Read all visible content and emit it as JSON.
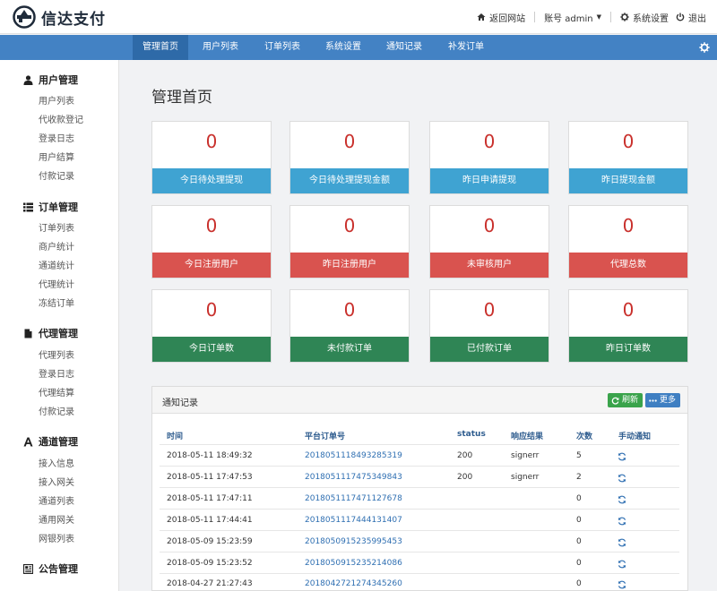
{
  "header": {
    "brand": "信达支付",
    "back_site": "返回网站",
    "account": "账号 admin",
    "settings": "系统设置",
    "logout": "退出"
  },
  "nav": {
    "items": [
      "管理首页",
      "用户列表",
      "订单列表",
      "系统设置",
      "通知记录",
      "补发订单"
    ],
    "active_index": 0
  },
  "sidebar": {
    "groups": [
      {
        "title": "用户管理",
        "icon": "user-icon",
        "items": [
          "用户列表",
          "代收款登记",
          "登录日志",
          "用户结算",
          "付款记录"
        ]
      },
      {
        "title": "订单管理",
        "icon": "list-icon",
        "items": [
          "订单列表",
          "商户统计",
          "通道统计",
          "代理统计",
          "冻结订单"
        ]
      },
      {
        "title": "代理管理",
        "icon": "document-icon",
        "items": [
          "代理列表",
          "登录日志",
          "代理结算",
          "付款记录"
        ]
      },
      {
        "title": "通道管理",
        "icon": "font-icon",
        "items": [
          "接入信息",
          "接入网关",
          "通道列表",
          "通用网关",
          "网银列表"
        ]
      },
      {
        "title": "公告管理",
        "icon": "newspaper-icon",
        "items": []
      }
    ]
  },
  "main": {
    "title": "管理首页",
    "stats": [
      {
        "value": "0",
        "label": "今日待处理提现",
        "color": "#3fa3d2"
      },
      {
        "value": "0",
        "label": "今日待处理提现金额",
        "color": "#3fa3d2"
      },
      {
        "value": "0",
        "label": "昨日申请提现",
        "color": "#3fa3d2"
      },
      {
        "value": "0",
        "label": "昨日提现金额",
        "color": "#3fa3d2"
      },
      {
        "value": "0",
        "label": "今日注册用户",
        "color": "#d9534f"
      },
      {
        "value": "0",
        "label": "昨日注册用户",
        "color": "#d9534f"
      },
      {
        "value": "0",
        "label": "未审核用户",
        "color": "#d9534f"
      },
      {
        "value": "0",
        "label": "代理总数",
        "color": "#d9534f"
      },
      {
        "value": "0",
        "label": "今日订单数",
        "color": "#2f8555"
      },
      {
        "value": "0",
        "label": "未付款订单",
        "color": "#2f8555"
      },
      {
        "value": "0",
        "label": "已付款订单",
        "color": "#2f8555"
      },
      {
        "value": "0",
        "label": "昨日订单数",
        "color": "#2f8555"
      }
    ],
    "notify": {
      "title": "通知记录",
      "refresh": "刷新",
      "more": "更多",
      "columns": [
        "时间",
        "平台订单号",
        "status",
        "响应结果",
        "次数",
        "手动通知"
      ],
      "rows": [
        {
          "time": "2018-05-11 18:49:32",
          "order": "2018051118493285319",
          "status": "200",
          "result": "signerr",
          "count": "5"
        },
        {
          "time": "2018-05-11 17:47:53",
          "order": "2018051117475349843",
          "status": "200",
          "result": "signerr",
          "count": "2"
        },
        {
          "time": "2018-05-11 17:47:11",
          "order": "2018051117471127678",
          "status": "",
          "result": "",
          "count": "0"
        },
        {
          "time": "2018-05-11 17:44:41",
          "order": "2018051117444131407",
          "status": "",
          "result": "",
          "count": "0"
        },
        {
          "time": "2018-05-09 15:23:59",
          "order": "2018050915235995453",
          "status": "",
          "result": "",
          "count": "0"
        },
        {
          "time": "2018-05-09 15:23:52",
          "order": "2018050915235214086",
          "status": "",
          "result": "",
          "count": "0"
        },
        {
          "time": "2018-04-27 21:27:43",
          "order": "2018042721274345260",
          "status": "",
          "result": "",
          "count": "0"
        }
      ]
    }
  }
}
